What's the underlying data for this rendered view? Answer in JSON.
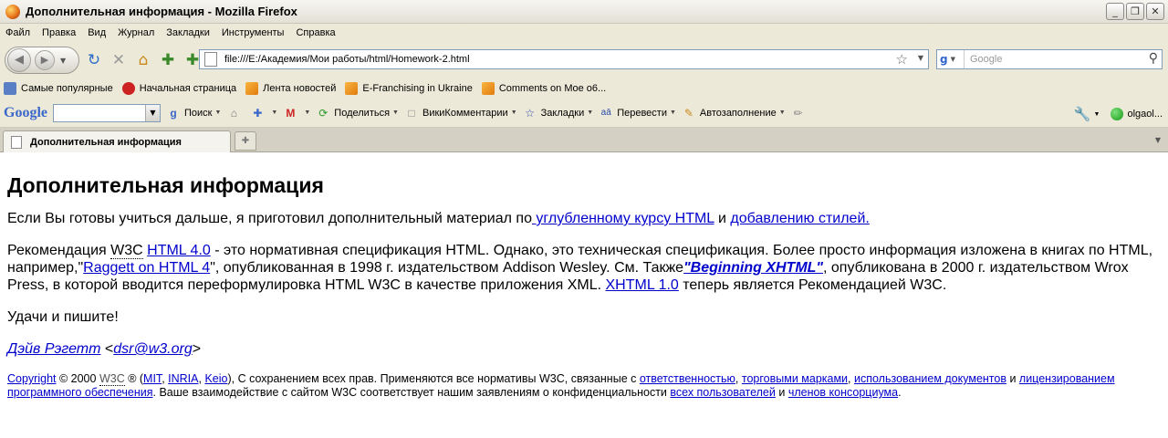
{
  "window": {
    "title": "Дополнительная информация - Mozilla Firefox",
    "min": "_",
    "max": "❐",
    "close": "✕"
  },
  "menu": [
    "Файл",
    "Правка",
    "Вид",
    "Журнал",
    "Закладки",
    "Инструменты",
    "Справка"
  ],
  "nav": {
    "url": "file:///E:/Академия/Мои работы/html/Homework-2.html",
    "search_placeholder": "Google",
    "search_engine": "g"
  },
  "bookmarks": [
    {
      "label": "Самые популярные",
      "icon": "popular-icon"
    },
    {
      "label": "Начальная страница",
      "icon": "home-icon"
    },
    {
      "label": "Лента новостей",
      "icon": "rss-icon"
    },
    {
      "label": "E-Franchising in Ukraine",
      "icon": "rss-icon"
    },
    {
      "label": "Comments on Moe o6...",
      "icon": "rss-icon"
    }
  ],
  "google_toolbar": {
    "logo": "Google",
    "search": "Поиск",
    "share": "Поделиться",
    "wiki": "ВикиКомментарии",
    "bookmarks": "Закладки",
    "translate": "Перевести",
    "autofill": "Автозаполнение",
    "account": "olgaol..."
  },
  "tab": {
    "label": "Дополнительная информация"
  },
  "content": {
    "heading": "Дополнительная информация",
    "p1_text": "Если Вы готовы учиться дальше, я приготовил дополнительный материал по",
    "p1_link1": " углубленному курсу HTML",
    "p1_and": " и ",
    "p1_link2": "добавлению стилей.",
    "p2_a": "Рекомендация ",
    "p2_w3c": "W3C",
    "p2_link1": "HTML 4.0",
    "p2_b": " - это нормативная спецификация HTML. Однако, это техническая спецификация. Более просто информация изложена в книгах по HTML, например,\"",
    "p2_link2": "Raggett on HTML 4",
    "p2_c": "\", опубликованная в 1998 г. издательством Addison Wesley. См. Также",
    "p2_link3": "\"Beginning XHTML\"",
    "p2_d": ", опубликована в 2000 г. издательством Wrox Press, в которой вводится переформулировка HTML W3C в качестве приложения XML. ",
    "p2_link4": "XHTML 1.0",
    "p2_e": " теперь является Рекомендацией W3C.",
    "p3": "Удачи и пишите!",
    "sig_name": "Дэйв Рэгетт",
    "sig_lt": " <",
    "sig_email": "dsr@w3.org",
    "sig_gt": ">",
    "footer": {
      "copyright": "Copyright",
      "year": " © 2000 ",
      "w3c": "W3C",
      "reg": " ® (",
      "mit": "MIT",
      "inria": "INRIA",
      "keio": "Keio",
      "t1": "), С сохранением всех прав. Применяются все нормативы W3C, связанные с ",
      "l1": "ответственностью",
      "l2": "торговыми марками",
      "l3": "использованием документов",
      "and1": " и ",
      "l4": "лицензированием программного обеспечения",
      "t2": ". Ваше взаимодействие с сайтом W3C соответствует нашим заявлениям о конфиденциальности ",
      "l5": "всех пользователей",
      "and2": " и ",
      "l6": "членов консорциума",
      "end": "."
    }
  }
}
